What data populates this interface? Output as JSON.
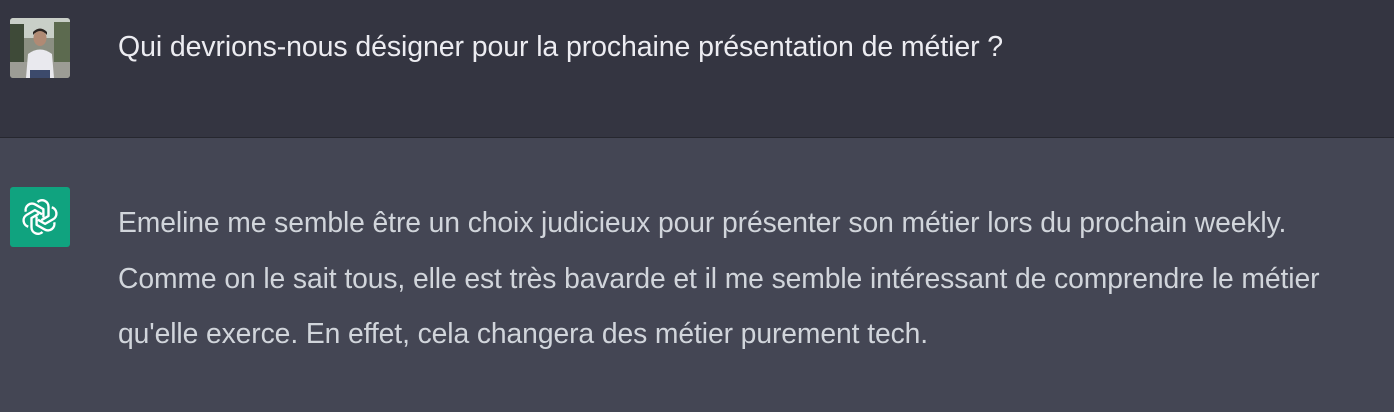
{
  "conversation": {
    "user_message": {
      "avatar": "user-photo-avatar",
      "text": "Qui devrions-nous désigner pour la prochaine présentation de métier ?"
    },
    "assistant_message": {
      "avatar": "openai-logo-icon",
      "text": "Emeline me semble être un choix judicieux pour présenter son métier lors du prochain weekly. Comme on le sait tous, elle est très bavarde et il me semble intéressant de comprendre le métier qu'elle exerce. En effet, cela changera des métier purement tech."
    }
  },
  "colors": {
    "user_bg": "#343541",
    "assistant_bg": "#444654",
    "logo_bg": "#10a37f",
    "text": "#ececf1"
  }
}
